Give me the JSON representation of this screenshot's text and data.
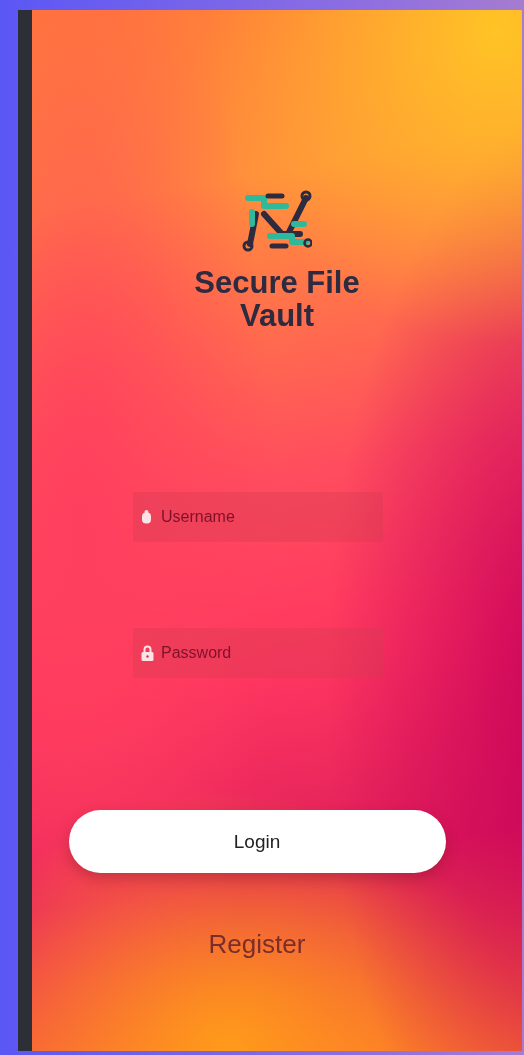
{
  "app": {
    "name": "Secure File Vault"
  },
  "fields": [
    {
      "kind": "username",
      "placeholder": "Username"
    },
    {
      "kind": "password",
      "placeholder": "Password"
    }
  ],
  "login_button": {
    "label": "Login"
  },
  "register_link": {
    "label": "Register"
  }
}
